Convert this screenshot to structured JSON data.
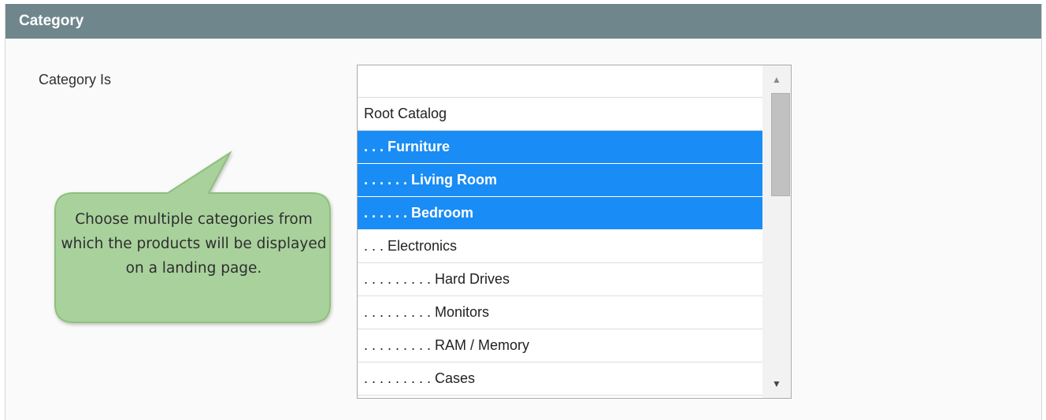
{
  "section": {
    "title": "Category"
  },
  "field": {
    "label": "Category Is"
  },
  "listbox": {
    "options": [
      {
        "label": "",
        "selected": false
      },
      {
        "label": "Root Catalog",
        "selected": false
      },
      {
        "label": ". . . Furniture",
        "selected": true
      },
      {
        "label": ". . . . . . Living Room",
        "selected": true
      },
      {
        "label": ". . . . . . Bedroom",
        "selected": true
      },
      {
        "label": ". . . Electronics",
        "selected": false
      },
      {
        "label": ". . . . . . . . . Hard Drives",
        "selected": false
      },
      {
        "label": ". . . . . . . . . Monitors",
        "selected": false
      },
      {
        "label": ". . . . . . . . . RAM / Memory",
        "selected": false
      },
      {
        "label": ". . . . . . . . . Cases",
        "selected": false
      }
    ],
    "scroll_up_icon": "triangle-up-icon",
    "scroll_down_icon": "triangle-down-icon"
  },
  "callout": {
    "text": "Choose multiple categories from which the products will be displayed on a landing page."
  },
  "colors": {
    "header_bg": "#6f868c",
    "selected_bg": "#1a8cf5",
    "callout_fill": "#a9d19c",
    "callout_stroke": "#8ec07c"
  }
}
